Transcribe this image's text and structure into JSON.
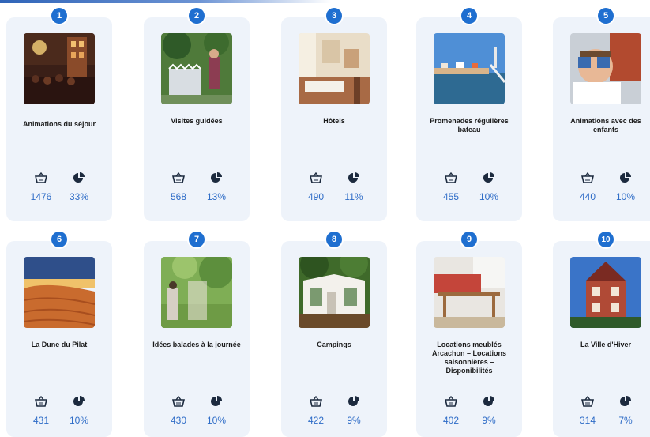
{
  "items": [
    {
      "rank": "1",
      "title": "Animations du séjour",
      "count": "1476",
      "share": "33%",
      "scene": "night-street-crowd"
    },
    {
      "rank": "2",
      "title": "Visites guidées",
      "count": "568",
      "share": "13%",
      "scene": "garden-gate-photographer"
    },
    {
      "rank": "3",
      "title": "Hôtels",
      "count": "490",
      "share": "11%",
      "scene": "hotel-room"
    },
    {
      "rank": "4",
      "title": "Promenades régulières bateau",
      "count": "455",
      "share": "10%",
      "scene": "seaside-pier"
    },
    {
      "rank": "5",
      "title": "Animations avec des enfants",
      "count": "440",
      "share": "10%",
      "scene": "child-binoculars"
    },
    {
      "rank": "6",
      "title": "La Dune du Pilat",
      "count": "431",
      "share": "10%",
      "scene": "sand-dune-sunset"
    },
    {
      "rank": "7",
      "title": "Idées balades à la journée",
      "count": "430",
      "share": "10%",
      "scene": "garden-walk"
    },
    {
      "rank": "8",
      "title": "Campings",
      "count": "422",
      "share": "9%",
      "scene": "mobile-home-camping"
    },
    {
      "rank": "9",
      "title": "Locations meublés Arcachon – Locations saisonnières – Disponibilités",
      "count": "402",
      "share": "9%",
      "scene": "furnished-living-room"
    },
    {
      "rank": "10",
      "title": "La Ville d'Hiver",
      "count": "314",
      "share": "7%",
      "scene": "winter-villa"
    }
  ],
  "icons": {
    "count": "basket-icon",
    "share": "pie-chart-icon"
  },
  "colors": {
    "badge": "#1f6fd0",
    "value": "#2e6cc7",
    "card": "#eef3fa"
  }
}
